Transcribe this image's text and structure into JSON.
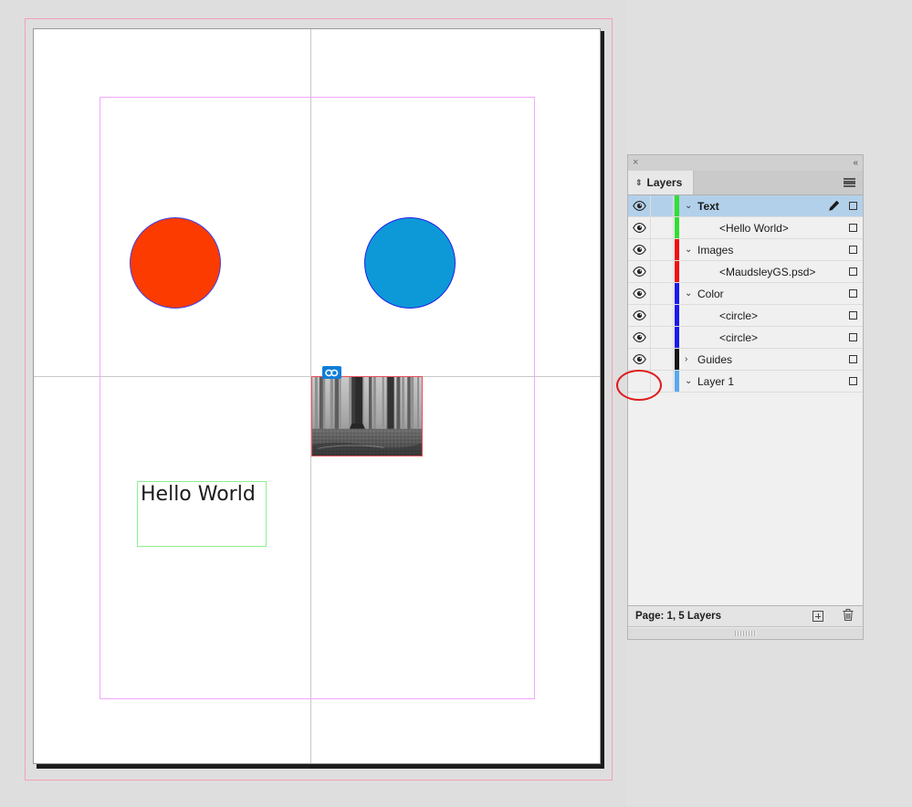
{
  "document": {
    "page_label": "Page 1",
    "objects": {
      "circle_orange": {
        "name": "orange-circle",
        "fill": "#fb3b00",
        "stroke": "#4040f0"
      },
      "circle_blue": {
        "name": "blue-circle",
        "fill": "#0d99d8",
        "stroke": "#2020e8"
      },
      "image_frame": {
        "name": "MaudsleyGS.psd",
        "frame_color": "#e8505c",
        "badge": "link-icon"
      },
      "text_frame": {
        "content": "Hello World",
        "frame_color": "#8ef08e"
      }
    },
    "guides": {
      "bleed_color": "#f4a0b4",
      "margin_color": "#f0a8ff",
      "ruler_guide_color": "#c8c8c8"
    }
  },
  "panel": {
    "close_glyph": "×",
    "collapse_glyph": "«",
    "tab_label": "Layers",
    "tab_grip_glyph": "⇕",
    "menu_icon": "hamburger-icon",
    "status": {
      "text": "Page: 1, 5 Layers",
      "new_layer_icon": "new-layer-icon",
      "delete_icon": "trash-icon"
    },
    "rows": [
      {
        "label": "Text",
        "swatch": "#33dd33",
        "indent": false,
        "bold": true,
        "visible": true,
        "selected": true,
        "disclosure": "⌄",
        "has_pen": true,
        "target": true
      },
      {
        "label": "<Hello World>",
        "swatch": "#33dd33",
        "indent": true,
        "bold": false,
        "visible": true,
        "selected": false,
        "disclosure": "",
        "has_pen": false,
        "target": true
      },
      {
        "label": "Images",
        "swatch": "#ee1111",
        "indent": false,
        "bold": false,
        "visible": true,
        "selected": false,
        "disclosure": "⌄",
        "has_pen": false,
        "target": true
      },
      {
        "label": "<MaudsleyGS.psd>",
        "swatch": "#ee1111",
        "indent": true,
        "bold": false,
        "visible": true,
        "selected": false,
        "disclosure": "",
        "has_pen": false,
        "target": true
      },
      {
        "label": "Color",
        "swatch": "#1a1aee",
        "indent": false,
        "bold": false,
        "visible": true,
        "selected": false,
        "disclosure": "⌄",
        "has_pen": false,
        "target": true
      },
      {
        "label": "<circle>",
        "swatch": "#1a1aee",
        "indent": true,
        "bold": false,
        "visible": true,
        "selected": false,
        "disclosure": "",
        "has_pen": false,
        "target": true
      },
      {
        "label": "<circle>",
        "swatch": "#1a1aee",
        "indent": true,
        "bold": false,
        "visible": true,
        "selected": false,
        "disclosure": "",
        "has_pen": false,
        "target": true
      },
      {
        "label": "Guides",
        "swatch": "#151515",
        "indent": false,
        "bold": false,
        "visible": true,
        "selected": false,
        "disclosure": "›",
        "has_pen": false,
        "target": true
      },
      {
        "label": "Layer 1",
        "swatch": "#5aa8ee",
        "indent": false,
        "bold": false,
        "visible": false,
        "selected": false,
        "disclosure": "⌄",
        "has_pen": false,
        "target": true
      }
    ]
  },
  "annotation": {
    "shape": "ellipse",
    "color": "#e01b1b",
    "describes": "hidden-visibility-toggle-for-layer-1"
  }
}
